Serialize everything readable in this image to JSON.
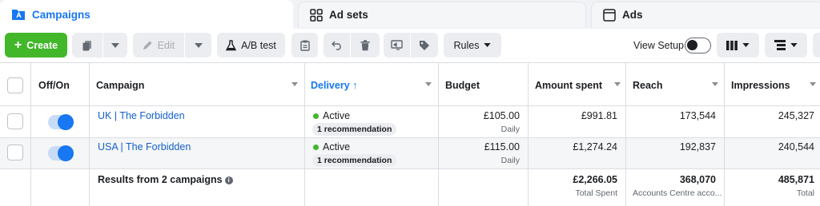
{
  "tabs": [
    {
      "label": "Campaigns",
      "icon": "folder-icon"
    },
    {
      "label": "Ad sets",
      "icon": "grid-icon"
    },
    {
      "label": "Ads",
      "icon": "ad-card-icon"
    }
  ],
  "toolbar": {
    "create_label": "Create",
    "edit_label": "Edit",
    "ab_test_label": "A/B test",
    "rules_label": "Rules",
    "view_setup_label": "View Setup"
  },
  "table": {
    "headers": {
      "off_on": "Off/On",
      "campaign": "Campaign",
      "delivery": "Delivery",
      "budget": "Budget",
      "amount_spent": "Amount spent",
      "reach": "Reach",
      "impressions": "Impressions"
    },
    "rows": [
      {
        "campaign": "UK | The Forbidden",
        "status": "Active",
        "recommendation": "1 recommendation",
        "budget": "£105.00",
        "budget_period": "Daily",
        "amount_spent": "£991.81",
        "reach": "173,544",
        "impressions": "245,327"
      },
      {
        "campaign": "USA | The Forbidden",
        "status": "Active",
        "recommendation": "1 recommendation",
        "budget": "£115.00",
        "budget_period": "Daily",
        "amount_spent": "£1,274.24",
        "reach": "192,837",
        "impressions": "240,544"
      }
    ],
    "totals": {
      "label": "Results from 2 campaigns",
      "amount_spent": "£2,266.05",
      "amount_spent_note": "Total Spent",
      "reach": "368,070",
      "reach_note": "Accounts Centre acco...",
      "impressions": "485,871",
      "impressions_note": "Total"
    }
  },
  "colors": {
    "accent": "#1877f2",
    "create": "#42b72a",
    "active_dot": "#42b72a",
    "link": "#1460c8"
  }
}
